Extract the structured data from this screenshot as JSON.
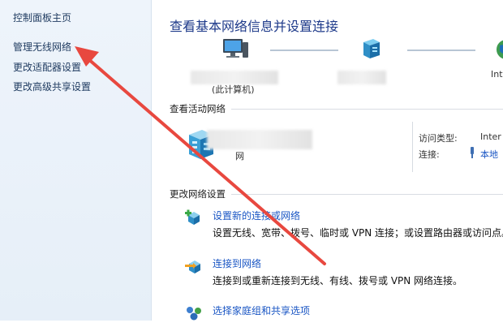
{
  "sidebar": {
    "items": [
      {
        "label": "控制面板主页"
      },
      {
        "label": "管理无线网络"
      },
      {
        "label": "更改适配器设置"
      },
      {
        "label": "更改高级共享设置"
      }
    ]
  },
  "main": {
    "title": "查看基本网络信息并设置连接",
    "network_map": {
      "computer_label": "(此计算机)",
      "internet_label": "Int"
    },
    "active_networks": {
      "heading": "查看活动网络",
      "network_name_fragment": "网",
      "access_type_label": "访问类型:",
      "access_type_value": "Inter",
      "connection_label": "连接:",
      "connection_value": "本地"
    },
    "change_settings": {
      "heading": "更改网络设置",
      "tasks": [
        {
          "link": "设置新的连接或网络",
          "desc": "设置无线、宽带、拨号、临时或 VPN 连接；或设置路由器或访问点。"
        },
        {
          "link": "连接到网络",
          "desc": "连接到或重新连接到无线、有线、拨号或 VPN 网络连接。"
        },
        {
          "link": "选择家庭组和共享选项",
          "desc": ""
        }
      ]
    }
  },
  "colors": {
    "accent_link": "#1a56c4",
    "title": "#1e3a8a",
    "annotation_arrow": "#e8483f",
    "sidebar_bg": "#eef4fb"
  }
}
